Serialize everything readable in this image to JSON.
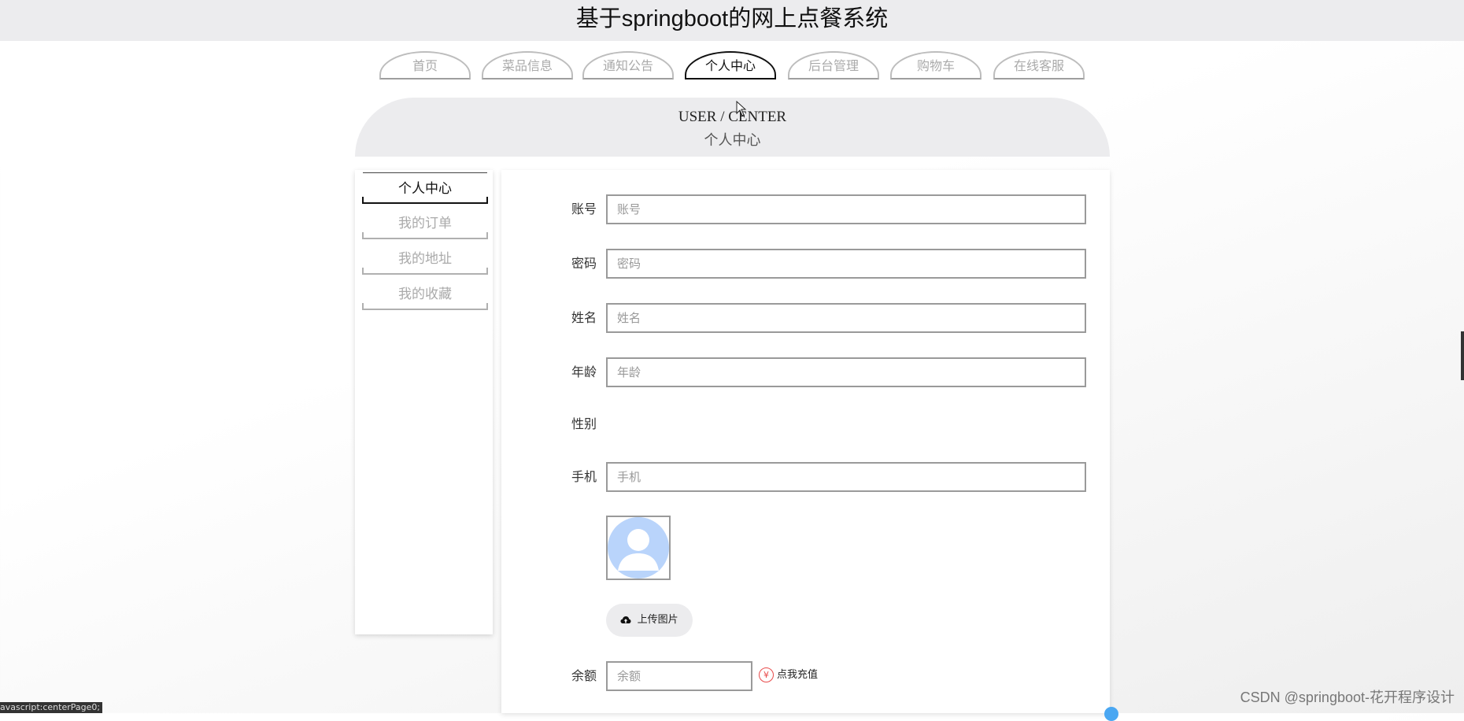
{
  "app": {
    "title": "基于springboot的网上点餐系统"
  },
  "nav": {
    "items": [
      {
        "label": "首页"
      },
      {
        "label": "菜品信息"
      },
      {
        "label": "通知公告"
      },
      {
        "label": "个人中心",
        "active": true
      },
      {
        "label": "后台管理"
      },
      {
        "label": "购物车"
      },
      {
        "label": "在线客服"
      }
    ]
  },
  "banner": {
    "en": "USER / CENTER",
    "cn": "个人中心"
  },
  "sidebar": {
    "items": [
      {
        "label": "个人中心",
        "active": true
      },
      {
        "label": "我的订单"
      },
      {
        "label": "我的地址"
      },
      {
        "label": "我的收藏"
      }
    ]
  },
  "form": {
    "account": {
      "label": "账号",
      "placeholder": "账号"
    },
    "password": {
      "label": "密码",
      "placeholder": "密码"
    },
    "name": {
      "label": "姓名",
      "placeholder": "姓名"
    },
    "age": {
      "label": "年龄",
      "placeholder": "年龄"
    },
    "gender": {
      "label": "性别"
    },
    "phone": {
      "label": "手机",
      "placeholder": "手机"
    },
    "avatar_icon": "default-avatar-icon",
    "upload_label": "上传图片",
    "balance": {
      "label": "余额",
      "placeholder": "余额"
    },
    "recharge_label": "点我充值"
  },
  "watermark": "CSDN @springboot-花开程序设计",
  "status_bar": "avascript:centerPage0;",
  "colors": {
    "accent": "#111111",
    "muted": "#aaaaaa",
    "banner_bg": "#ececee",
    "recharge": "#e84b4b"
  }
}
